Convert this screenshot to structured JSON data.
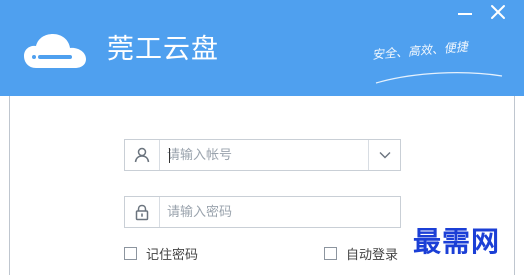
{
  "app": {
    "title": "莞工云盘",
    "slogan": "安全、高效、便捷"
  },
  "window_controls": {
    "minimize": "minimize-icon",
    "close": "close-icon"
  },
  "login": {
    "username_placeholder": "请输入帐号",
    "username_value": "",
    "password_placeholder": "请输入密码",
    "password_value": "",
    "remember_label": "记住密码",
    "remember_checked": false,
    "auto_login_label": "自动登录",
    "auto_login_checked": false
  },
  "icons": {
    "logo": "cloud-icon",
    "user": "user-icon",
    "lock": "lock-icon",
    "dropdown": "chevron-down-icon"
  },
  "watermark": "最需网",
  "colors": {
    "header": "#4fa0ef",
    "watermark": "#1b3fd6"
  }
}
